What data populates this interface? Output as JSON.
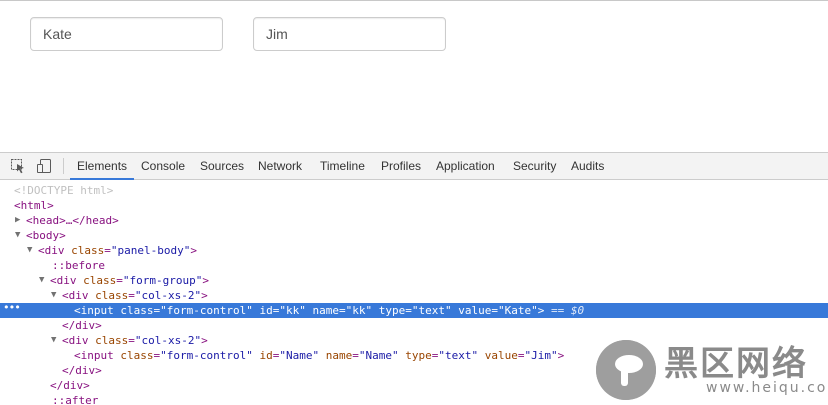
{
  "page": {
    "inputs": [
      {
        "value": "Kate"
      },
      {
        "value": "Jim"
      }
    ]
  },
  "devtools": {
    "tabs": [
      "Elements",
      "Console",
      "Sources",
      "Network",
      "Timeline",
      "Profiles",
      "Application",
      "Security",
      "Audits"
    ],
    "active_tab": "Elements",
    "dom_lines": {
      "doctype": "<!DOCTYPE html>",
      "html_open": "<html>",
      "head": "<head>…</head>",
      "body_open": "<body>",
      "panel_body": {
        "tag_open": "<div ",
        "attr": "class",
        "value": "\"panel-body\"",
        "close": ">"
      },
      "before": "::before",
      "form_group": {
        "tag_open": "<div ",
        "attr": "class",
        "value": "\"form-group\"",
        "close": ">"
      },
      "col1": {
        "tag_open": "<div ",
        "attr": "class",
        "value": "\"col-xs-2\"",
        "close": ">"
      },
      "input1": {
        "tag_open": "<input ",
        "a1": "class",
        "v1": "\"form-control\"",
        "a2": "id",
        "v2": "\"kk\"",
        "a3": "name",
        "v3": "\"kk\"",
        "a4": "type",
        "v4": "\"text\"",
        "a5": "value",
        "v5": "\"Kate\"",
        "close": ">",
        "selection_ref": "== $0"
      },
      "div_close1": "</div>",
      "col2": {
        "tag_open": "<div ",
        "attr": "class",
        "value": "\"col-xs-2\"",
        "close": ">"
      },
      "input2": {
        "tag_open": "<input ",
        "a1": "class",
        "v1": "\"form-control\"",
        "a2": "id",
        "v2": "\"Name\"",
        "a3": "name",
        "v3": "\"Name\"",
        "a4": "type",
        "v4": "\"text\"",
        "a5": "value",
        "v5": "\"Jim\"",
        "close": ">"
      },
      "div_close2": "</div>",
      "div_close3": "</div>",
      "after": "::after"
    }
  },
  "watermark": {
    "title": "黑区网络",
    "url": "www.heiqu.com"
  },
  "colors": {
    "accent": "#3879d9",
    "tag": "#881280",
    "attr": "#994500",
    "value": "#1a1aa6"
  }
}
